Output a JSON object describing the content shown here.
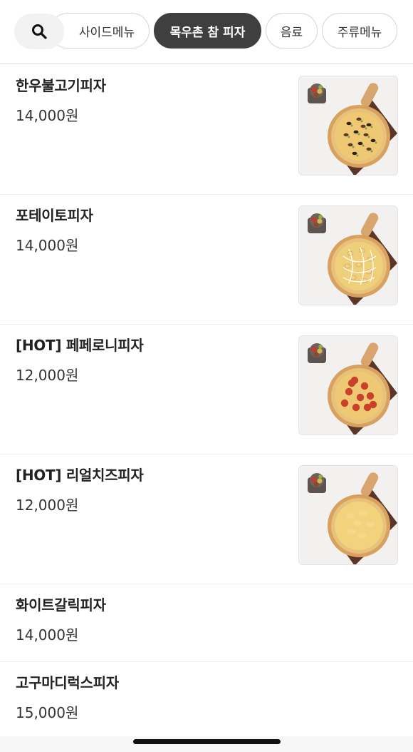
{
  "categories": {
    "search_icon": "search-icon",
    "items": [
      {
        "label": "사이드메뉴",
        "active": false
      },
      {
        "label": "목우촌 참 피자",
        "active": true
      },
      {
        "label": "음료",
        "active": false
      },
      {
        "label": "주류메뉴",
        "active": false
      }
    ]
  },
  "menu": [
    {
      "name": "한우불고기피자",
      "price": "14,000원",
      "topping": "bulgogi"
    },
    {
      "name": "포테이토피자",
      "price": "14,000원",
      "topping": "potato"
    },
    {
      "name": "[HOT] 페페로니피자",
      "price": "12,000원",
      "topping": "pepperoni"
    },
    {
      "name": "[HOT] 리얼치즈피자",
      "price": "12,000원",
      "topping": "cheese"
    },
    {
      "name": "화이트갈릭피자",
      "price": "14,000원"
    },
    {
      "name": "고구마디럭스피자",
      "price": "15,000원"
    }
  ],
  "colors": {
    "active_chip": "#3f3f3f",
    "board": "#5a3628",
    "crust": "#e8c17a"
  }
}
